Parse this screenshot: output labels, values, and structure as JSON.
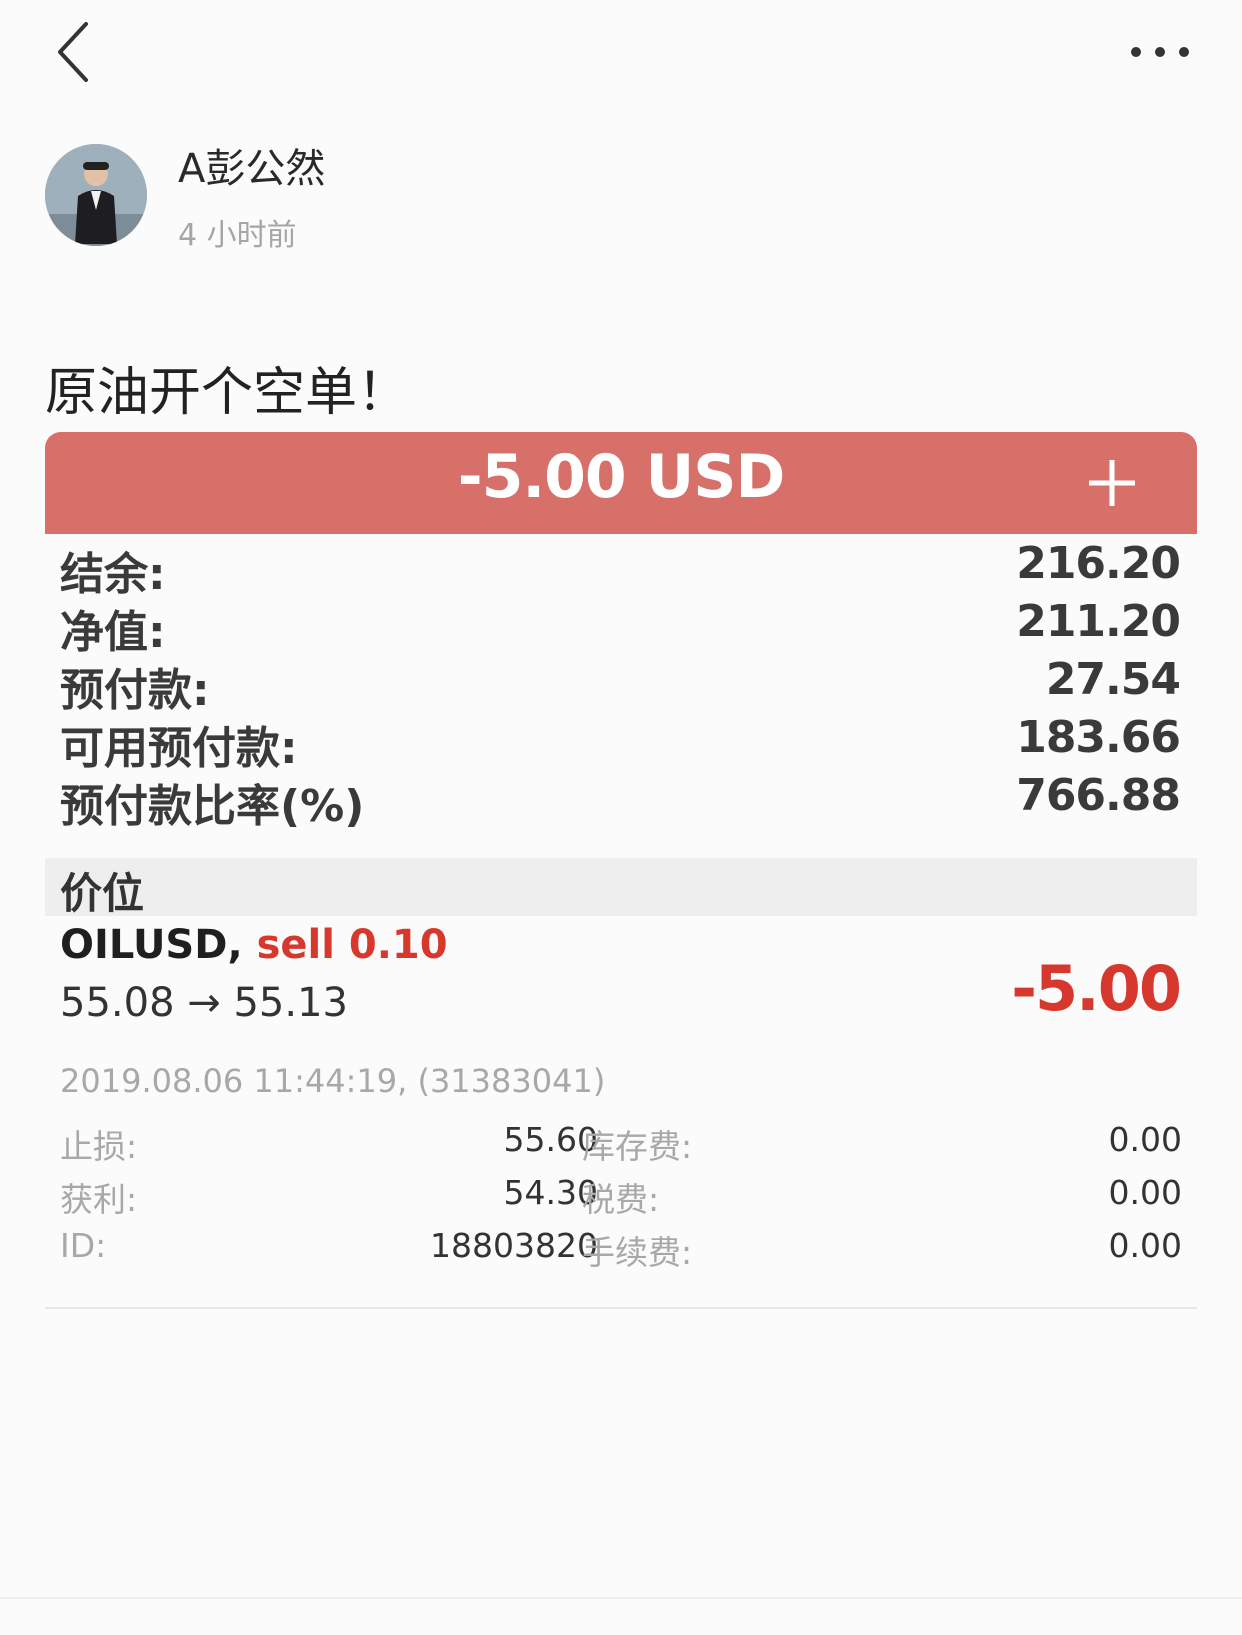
{
  "author": {
    "name": "A彭公然",
    "time": "4 小时前"
  },
  "post": {
    "text": "原油开个空单！"
  },
  "card": {
    "total_pl": "-5.00 USD",
    "header_color": "#d8706a",
    "summary": [
      {
        "label": "结余:",
        "value": "216.20"
      },
      {
        "label": "净值:",
        "value": "211.20"
      },
      {
        "label": "预付款:",
        "value": "27.54"
      },
      {
        "label": "可用预付款:",
        "value": "183.66"
      },
      {
        "label": "预付款比率(%)",
        "value": "766.88"
      }
    ],
    "section_title": "价位",
    "position": {
      "symbol": "OILUSD,",
      "side": "sell 0.10",
      "prices": "55.08 → 55.13",
      "profit": "-5.00",
      "time": "2019.08.06 11:44:19, (31383041)",
      "details_left": [
        {
          "label": "止损:",
          "value": "55.60"
        },
        {
          "label": "获利:",
          "value": "54.30"
        },
        {
          "label": "ID:",
          "value": "18803820"
        }
      ],
      "details_right": [
        {
          "label": "库存费:",
          "value": "0.00"
        },
        {
          "label": "税费:",
          "value": "0.00"
        },
        {
          "label": "手续费:",
          "value": "0.00"
        }
      ]
    }
  },
  "icons": {
    "back": "chevron-left-icon",
    "more": "more-dots-icon",
    "plus": "plus-icon"
  },
  "colors": {
    "loss_red": "#d6382d"
  }
}
